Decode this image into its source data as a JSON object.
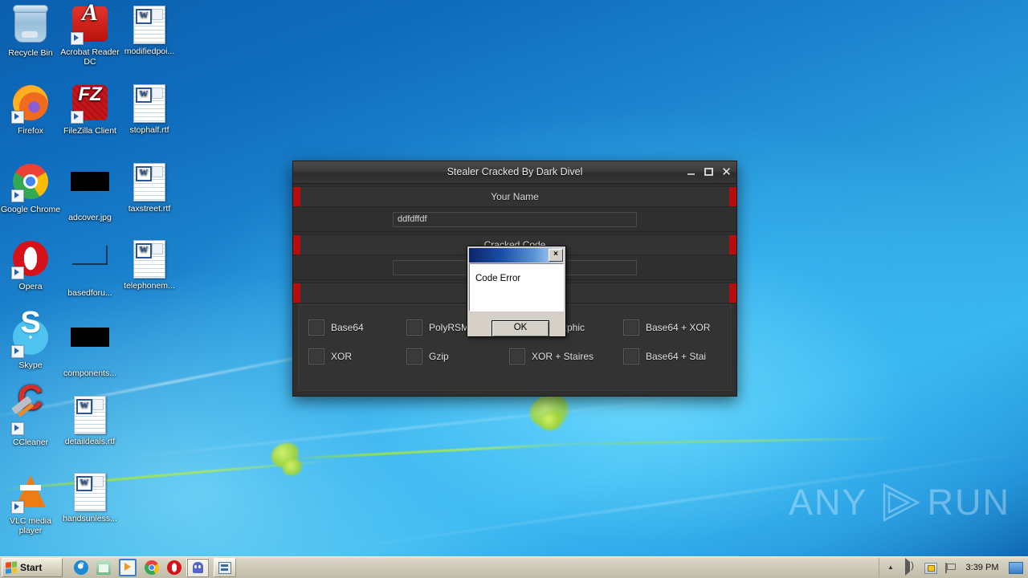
{
  "desktop": {
    "icons": [
      {
        "label": "Recycle Bin",
        "art": "bin",
        "shortcut": false
      },
      {
        "label": "Acrobat Reader DC",
        "art": "acrobat",
        "shortcut": true
      },
      {
        "label": "modifiedpoi...",
        "art": "word-doc",
        "shortcut": false
      },
      {
        "label": "Firefox",
        "art": "firefox",
        "shortcut": true
      },
      {
        "label": "FileZilla Client",
        "art": "filezilla",
        "shortcut": true
      },
      {
        "label": "stophalf.rtf",
        "art": "word-doc",
        "shortcut": false
      },
      {
        "label": "Google Chrome",
        "art": "chrome",
        "shortcut": true
      },
      {
        "label": "adcover.jpg",
        "art": "black-image",
        "shortcut": false
      },
      {
        "label": "taxstreet.rtf",
        "art": "word-doc",
        "shortcut": false
      },
      {
        "label": "Opera",
        "art": "opera",
        "shortcut": true
      },
      {
        "label": "basedforu...",
        "art": "black-outline-image",
        "shortcut": false
      },
      {
        "label": "telephonem...",
        "art": "word-doc",
        "shortcut": false
      },
      {
        "label": "Skype",
        "art": "skype",
        "shortcut": true
      },
      {
        "label": "components...",
        "art": "black-image",
        "shortcut": false
      },
      {
        "label": "CCleaner",
        "art": "ccleaner",
        "shortcut": true
      },
      {
        "label": "detaildeals.rtf",
        "art": "word-doc",
        "shortcut": false
      },
      {
        "label": "VLC media player",
        "art": "vlc",
        "shortcut": true
      },
      {
        "label": "handsunless...",
        "art": "word-doc",
        "shortcut": false
      }
    ],
    "watermark": {
      "text_left": "ANY",
      "text_right": "RUN",
      "logo": "play-triangle-logo"
    }
  },
  "app_window": {
    "title": "Stealer Cracked By Dark Divel",
    "buttons": {
      "minimize": "minimize-icon",
      "maximize": "maximize-icon",
      "close": "close-icon"
    },
    "name_label": "Your Name",
    "name_value": "ddfdffdf",
    "name_placeholder": "",
    "code_label": "Cracked Code",
    "code_value": "",
    "code_placeholder": "",
    "third_label": "",
    "third_value": "",
    "accent_color": "#b70d0d",
    "options": [
      {
        "label": "Base64",
        "checked": false
      },
      {
        "label": "PolyRSM",
        "checked": false
      },
      {
        "label": "Polymorphic",
        "checked": false
      },
      {
        "label": "Base64 + XOR",
        "checked": false
      },
      {
        "label": "XOR",
        "checked": false
      },
      {
        "label": "Gzip",
        "checked": false
      },
      {
        "label": "XOR + Staires",
        "checked": false
      },
      {
        "label": "Base64 + Stai",
        "checked": false
      }
    ]
  },
  "dialog": {
    "title": "",
    "close_label": "×",
    "message": "Code Error",
    "ok_label": "OK"
  },
  "taskbar": {
    "start_label": "Start",
    "quick_launch": [
      {
        "name": "internet-explorer-icon"
      },
      {
        "name": "windows-explorer-icon"
      },
      {
        "name": "windows-media-player-icon"
      },
      {
        "name": "google-chrome-icon"
      },
      {
        "name": "opera-icon"
      }
    ],
    "tasks": [
      {
        "name": "stealer-app-task",
        "icon": "ghost-icon",
        "active": true
      },
      {
        "name": "document-task",
        "icon": "app-window-icon",
        "active": false
      }
    ],
    "tray": {
      "chevron": "show-hidden-icons",
      "volume": "volume-icon",
      "network": "network-warning-icon",
      "action_center": "flag-icon",
      "clock": "3:39 PM",
      "show_desktop": "show-desktop-button"
    }
  }
}
